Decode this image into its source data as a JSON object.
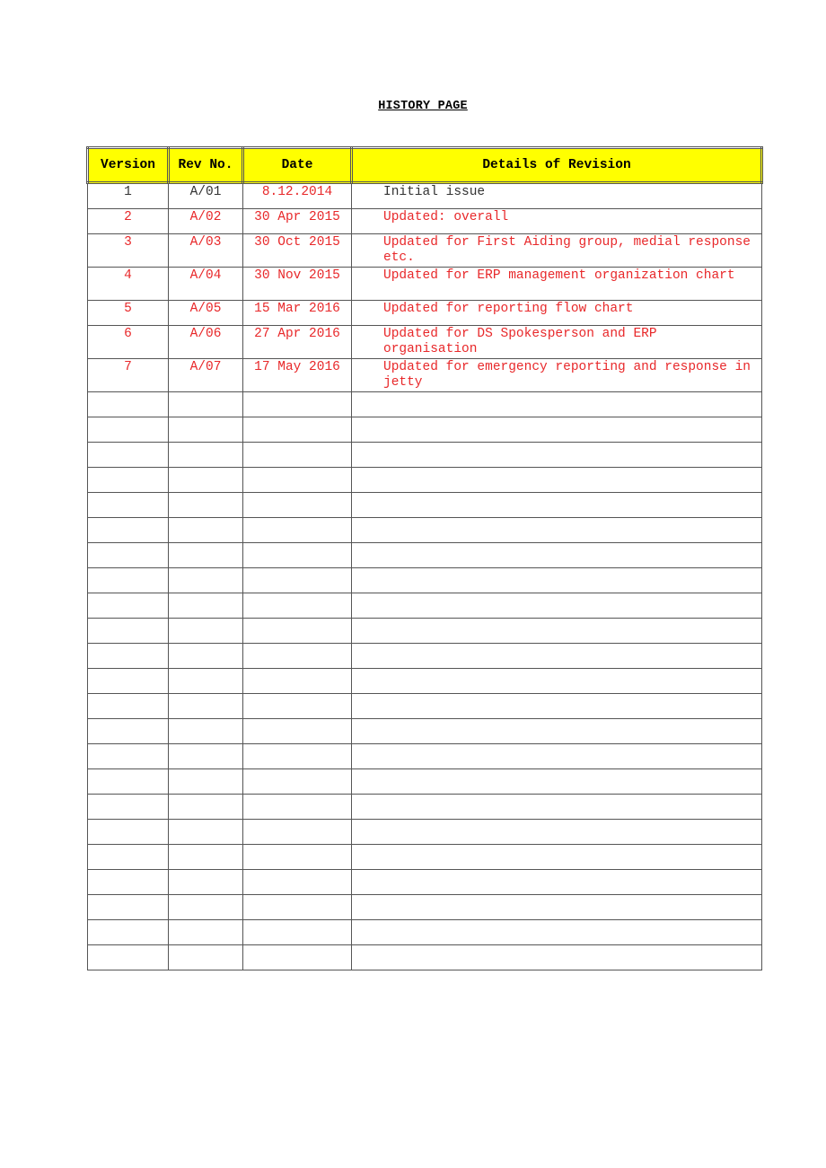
{
  "document": {
    "title": "HISTORY PAGE"
  },
  "colors": {
    "header_fill": "#ffff00",
    "revision_text": "#e8282a",
    "initial_text": "#333333",
    "border": "#555555"
  },
  "table": {
    "headers": {
      "version": "Version",
      "rev_no": "Rev No.",
      "date": "Date",
      "details": "Details of Revision"
    },
    "rows": [
      {
        "version": "1",
        "rev_no": "A/01",
        "date": "8.12.2014",
        "details": "Initial issue"
      },
      {
        "version": "2",
        "rev_no": "A/02",
        "date": "30 Apr 2015",
        "details": "Updated: overall"
      },
      {
        "version": "3",
        "rev_no": "A/03",
        "date": "30 Oct 2015",
        "details": "Updated for First Aiding group, medial response etc."
      },
      {
        "version": "4",
        "rev_no": "A/04",
        "date": "30 Nov 2015",
        "details": "Updated for ERP management organization chart"
      },
      {
        "version": "5",
        "rev_no": "A/05",
        "date": "15 Mar 2016",
        "details": "Updated for reporting flow chart"
      },
      {
        "version": "6",
        "rev_no": "A/06",
        "date": "27 Apr 2016",
        "details": "Updated for DS Spokesperson and ERP organisation"
      },
      {
        "version": "7",
        "rev_no": "A/07",
        "date": "17 May 2016",
        "details": "Updated for emergency reporting and response in jetty"
      }
    ],
    "empty_row_count": 23
  }
}
